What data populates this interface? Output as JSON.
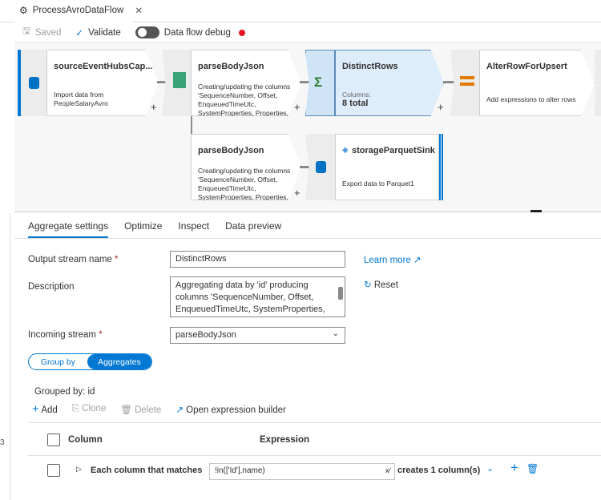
{
  "tab": {
    "title": "ProcessAvroDataFlow"
  },
  "toolbar": {
    "saved": "Saved",
    "validate": "Validate",
    "debug": "Data flow debug",
    "debug_status_color": "#e81123"
  },
  "nodes": {
    "source": {
      "title": "sourceEventHubsCap...",
      "desc1": "Import data from",
      "desc2": "PeopleSalaryAvro"
    },
    "parse1": {
      "title": "parseBodyJson",
      "desc": [
        "Creating/updating the columns",
        "'SequenceNumber, Offset,",
        "EnqueuedTimeUtc,",
        "SystemProperties, Properties,"
      ]
    },
    "distinct": {
      "title": "DistinctRows",
      "cols_label": "Columns:",
      "cols_value": "8 total"
    },
    "alter": {
      "title": "AlterRowForUpsert",
      "desc": "Add expressions to alter rows"
    },
    "parse2": {
      "title": "parseBodyJson",
      "desc": [
        "Creating/updating the columns",
        "'SequenceNumber, Offset,",
        "EnqueuedTimeUtc,",
        "SystemProperties, Properties,"
      ]
    },
    "sink": {
      "title": "storageParquetSink",
      "desc": "Export data to Parquet1"
    },
    "plus": "+"
  },
  "panel": {
    "tabs": [
      "Aggregate settings",
      "Optimize",
      "Inspect",
      "Data preview"
    ],
    "output_label": "Output stream name",
    "required": "*",
    "output_value": "DistinctRows",
    "learn_more": "Learn more",
    "description_label": "Description",
    "description_value": "Aggregating data by 'id' producing columns 'SequenceNumber, Offset, EnqueuedTimeUtc, SystemProperties,",
    "reset": "Reset",
    "incoming_label": "Incoming stream",
    "incoming_value": "parseBodyJson",
    "toggle": [
      "Group by",
      "Aggregates"
    ],
    "grouped_by": "Grouped by: id",
    "actions": {
      "add": "Add",
      "clone": "Clone",
      "delete": "Delete",
      "expr_builder": "Open expression builder"
    },
    "columns": {
      "column": "Column",
      "expression": "Expression"
    },
    "row": {
      "label": "Each column that matches",
      "expression": "!in(['Id'],name)",
      "creates": "creates 1 column(s)"
    }
  },
  "left_edge_text": "3"
}
